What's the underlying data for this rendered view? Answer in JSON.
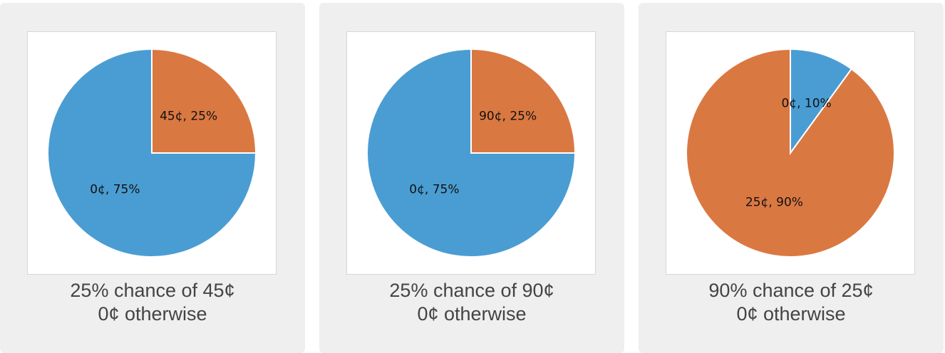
{
  "colors": {
    "zero_outcome": "#4a9dd2",
    "win_outcome": "#da7842"
  },
  "cards": [
    {
      "caption_line1": "25% chance of 45¢",
      "caption_line2": "0¢ otherwise"
    },
    {
      "caption_line1": "25% chance of 90¢",
      "caption_line2": "0¢ otherwise"
    },
    {
      "caption_line1": "90% chance of 25¢",
      "caption_line2": "0¢ otherwise"
    }
  ],
  "chart_data": [
    {
      "type": "pie",
      "slices": [
        {
          "label": "45¢, 25%",
          "value": 25,
          "color": "#da7842"
        },
        {
          "label": "0¢, 75%",
          "value": 75,
          "color": "#4a9dd2"
        }
      ]
    },
    {
      "type": "pie",
      "slices": [
        {
          "label": "90¢, 25%",
          "value": 25,
          "color": "#da7842"
        },
        {
          "label": "0¢, 75%",
          "value": 75,
          "color": "#4a9dd2"
        }
      ]
    },
    {
      "type": "pie",
      "slices": [
        {
          "label": "0¢, 10%",
          "value": 10,
          "color": "#4a9dd2"
        },
        {
          "label": "25¢, 90%",
          "value": 90,
          "color": "#da7842"
        }
      ]
    }
  ]
}
